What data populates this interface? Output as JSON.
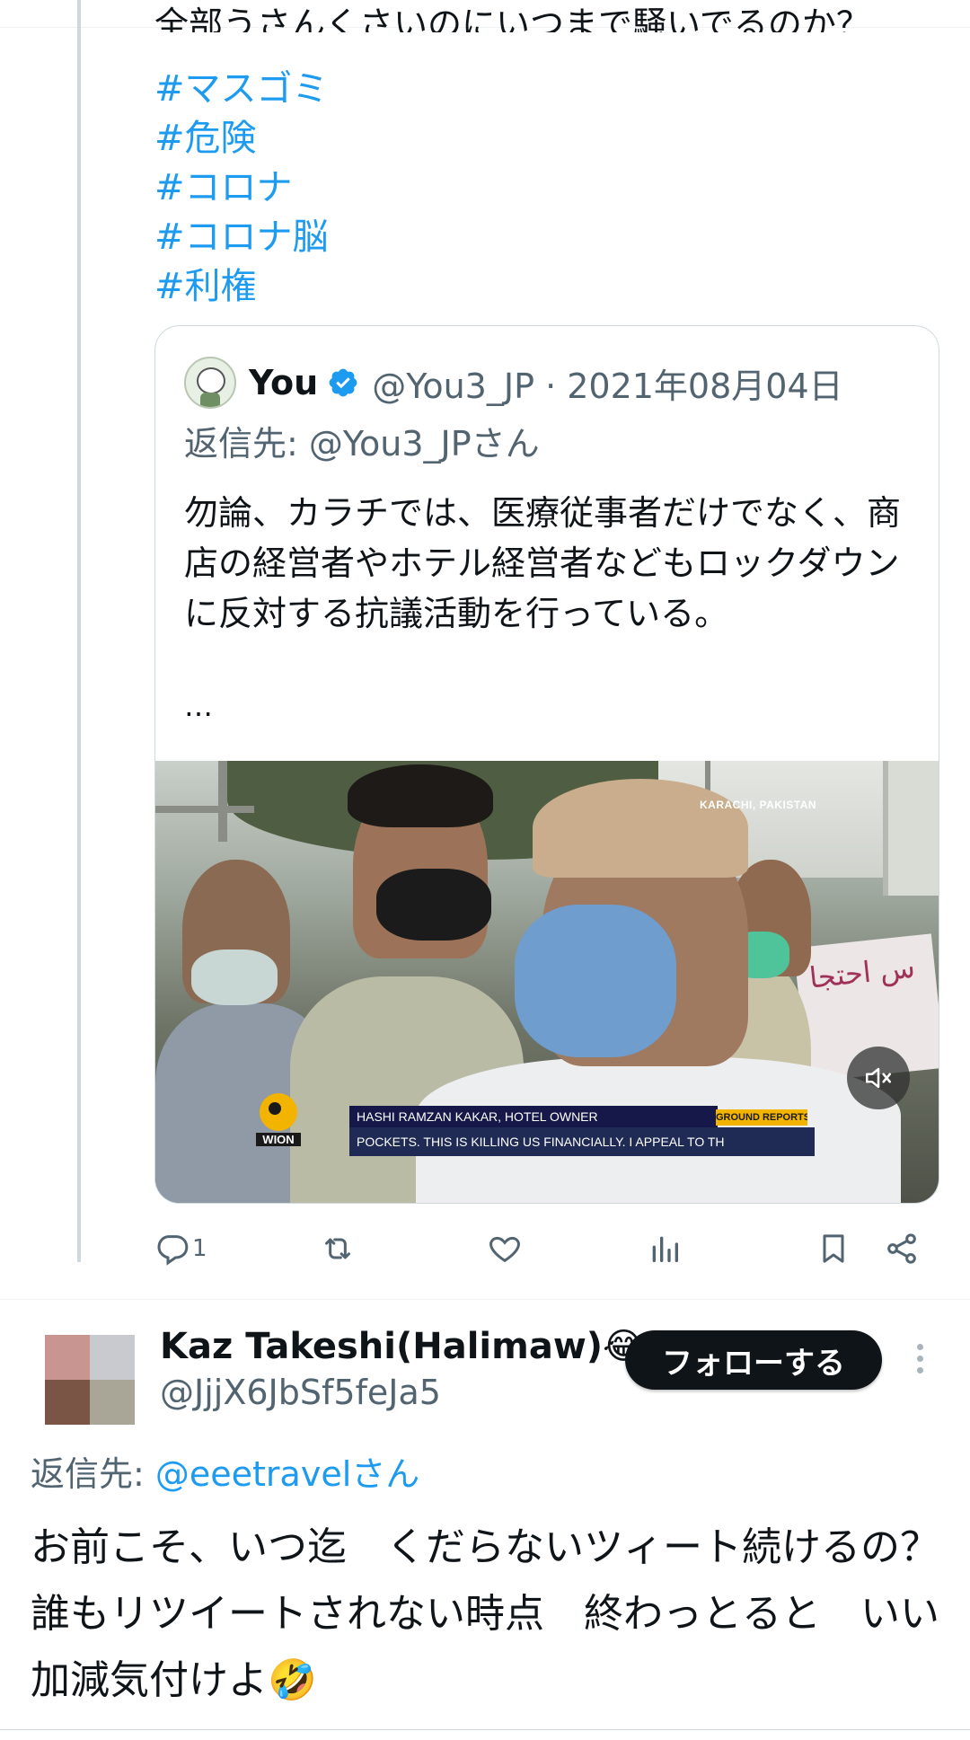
{
  "parent_tweet": {
    "text_fragment": "全部うさんくさいのにいつまで騒いでるのか？",
    "hashtags": [
      "#マスゴミ",
      "#危険",
      "#コロナ",
      "#コロナ脳",
      "#利権"
    ]
  },
  "quoted_tweet": {
    "name": "You",
    "handle_date": "@You3_JP · 2021年08月04日",
    "reply_to": "返信先: @You3_JPさん",
    "body": "勿論、カラチでは、医療従事者だけでなく、商店の経営者やホテル経営者などもロックダウンに反対する抗議活動を行っている。",
    "more": "…",
    "video": {
      "location": "KARACHI, PAKISTAN",
      "logo_text": "WION",
      "lower_third_name": "HASHI RAMZAN KAKAR, HOTEL OWNER",
      "lower_third_tag": "GROUND REPORTS",
      "lower_third_quote": "POCKETS. THIS IS KILLING US FINANCIALLY. I APPEAL TO TH",
      "banner_text": "س احتجا"
    }
  },
  "actions": {
    "reply_count": "1"
  },
  "reply_tweet": {
    "name": "Kaz Takeshi(Halimaw)😂",
    "handle": "@JjjX6JbSf5feJa5",
    "follow_label": "フォローする",
    "reply_to_prefix": "返信先: ",
    "reply_to_mention": "@eeetravelさん",
    "body": "お前こそ、いつ迄　くだらないツィート続けるの？誰もリツイートされない時点　終わっとると　いい加減気付けよ🤣"
  },
  "colors": {
    "accent": "#1d9bf0",
    "text": "#0f1419",
    "secondary": "#536471",
    "follow_button": "#0f1419"
  }
}
